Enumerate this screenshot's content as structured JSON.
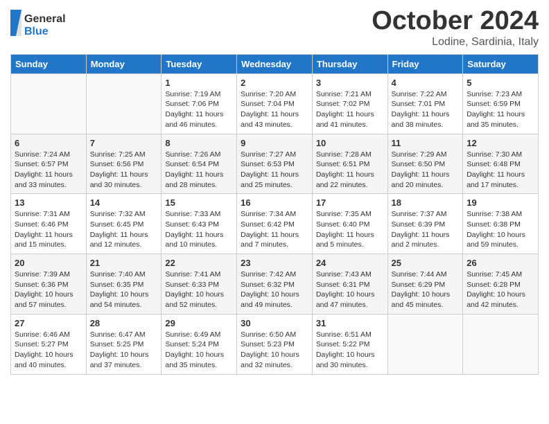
{
  "header": {
    "logo_general": "General",
    "logo_blue": "Blue",
    "month": "October 2024",
    "location": "Lodine, Sardinia, Italy"
  },
  "days_of_week": [
    "Sunday",
    "Monday",
    "Tuesday",
    "Wednesday",
    "Thursday",
    "Friday",
    "Saturday"
  ],
  "weeks": [
    [
      {
        "day": "",
        "sunrise": "",
        "sunset": "",
        "daylight": ""
      },
      {
        "day": "",
        "sunrise": "",
        "sunset": "",
        "daylight": ""
      },
      {
        "day": "1",
        "sunrise": "Sunrise: 7:19 AM",
        "sunset": "Sunset: 7:06 PM",
        "daylight": "Daylight: 11 hours and 46 minutes."
      },
      {
        "day": "2",
        "sunrise": "Sunrise: 7:20 AM",
        "sunset": "Sunset: 7:04 PM",
        "daylight": "Daylight: 11 hours and 43 minutes."
      },
      {
        "day": "3",
        "sunrise": "Sunrise: 7:21 AM",
        "sunset": "Sunset: 7:02 PM",
        "daylight": "Daylight: 11 hours and 41 minutes."
      },
      {
        "day": "4",
        "sunrise": "Sunrise: 7:22 AM",
        "sunset": "Sunset: 7:01 PM",
        "daylight": "Daylight: 11 hours and 38 minutes."
      },
      {
        "day": "5",
        "sunrise": "Sunrise: 7:23 AM",
        "sunset": "Sunset: 6:59 PM",
        "daylight": "Daylight: 11 hours and 35 minutes."
      }
    ],
    [
      {
        "day": "6",
        "sunrise": "Sunrise: 7:24 AM",
        "sunset": "Sunset: 6:57 PM",
        "daylight": "Daylight: 11 hours and 33 minutes."
      },
      {
        "day": "7",
        "sunrise": "Sunrise: 7:25 AM",
        "sunset": "Sunset: 6:56 PM",
        "daylight": "Daylight: 11 hours and 30 minutes."
      },
      {
        "day": "8",
        "sunrise": "Sunrise: 7:26 AM",
        "sunset": "Sunset: 6:54 PM",
        "daylight": "Daylight: 11 hours and 28 minutes."
      },
      {
        "day": "9",
        "sunrise": "Sunrise: 7:27 AM",
        "sunset": "Sunset: 6:53 PM",
        "daylight": "Daylight: 11 hours and 25 minutes."
      },
      {
        "day": "10",
        "sunrise": "Sunrise: 7:28 AM",
        "sunset": "Sunset: 6:51 PM",
        "daylight": "Daylight: 11 hours and 22 minutes."
      },
      {
        "day": "11",
        "sunrise": "Sunrise: 7:29 AM",
        "sunset": "Sunset: 6:50 PM",
        "daylight": "Daylight: 11 hours and 20 minutes."
      },
      {
        "day": "12",
        "sunrise": "Sunrise: 7:30 AM",
        "sunset": "Sunset: 6:48 PM",
        "daylight": "Daylight: 11 hours and 17 minutes."
      }
    ],
    [
      {
        "day": "13",
        "sunrise": "Sunrise: 7:31 AM",
        "sunset": "Sunset: 6:46 PM",
        "daylight": "Daylight: 11 hours and 15 minutes."
      },
      {
        "day": "14",
        "sunrise": "Sunrise: 7:32 AM",
        "sunset": "Sunset: 6:45 PM",
        "daylight": "Daylight: 11 hours and 12 minutes."
      },
      {
        "day": "15",
        "sunrise": "Sunrise: 7:33 AM",
        "sunset": "Sunset: 6:43 PM",
        "daylight": "Daylight: 11 hours and 10 minutes."
      },
      {
        "day": "16",
        "sunrise": "Sunrise: 7:34 AM",
        "sunset": "Sunset: 6:42 PM",
        "daylight": "Daylight: 11 hours and 7 minutes."
      },
      {
        "day": "17",
        "sunrise": "Sunrise: 7:35 AM",
        "sunset": "Sunset: 6:40 PM",
        "daylight": "Daylight: 11 hours and 5 minutes."
      },
      {
        "day": "18",
        "sunrise": "Sunrise: 7:37 AM",
        "sunset": "Sunset: 6:39 PM",
        "daylight": "Daylight: 11 hours and 2 minutes."
      },
      {
        "day": "19",
        "sunrise": "Sunrise: 7:38 AM",
        "sunset": "Sunset: 6:38 PM",
        "daylight": "Daylight: 10 hours and 59 minutes."
      }
    ],
    [
      {
        "day": "20",
        "sunrise": "Sunrise: 7:39 AM",
        "sunset": "Sunset: 6:36 PM",
        "daylight": "Daylight: 10 hours and 57 minutes."
      },
      {
        "day": "21",
        "sunrise": "Sunrise: 7:40 AM",
        "sunset": "Sunset: 6:35 PM",
        "daylight": "Daylight: 10 hours and 54 minutes."
      },
      {
        "day": "22",
        "sunrise": "Sunrise: 7:41 AM",
        "sunset": "Sunset: 6:33 PM",
        "daylight": "Daylight: 10 hours and 52 minutes."
      },
      {
        "day": "23",
        "sunrise": "Sunrise: 7:42 AM",
        "sunset": "Sunset: 6:32 PM",
        "daylight": "Daylight: 10 hours and 49 minutes."
      },
      {
        "day": "24",
        "sunrise": "Sunrise: 7:43 AM",
        "sunset": "Sunset: 6:31 PM",
        "daylight": "Daylight: 10 hours and 47 minutes."
      },
      {
        "day": "25",
        "sunrise": "Sunrise: 7:44 AM",
        "sunset": "Sunset: 6:29 PM",
        "daylight": "Daylight: 10 hours and 45 minutes."
      },
      {
        "day": "26",
        "sunrise": "Sunrise: 7:45 AM",
        "sunset": "Sunset: 6:28 PM",
        "daylight": "Daylight: 10 hours and 42 minutes."
      }
    ],
    [
      {
        "day": "27",
        "sunrise": "Sunrise: 6:46 AM",
        "sunset": "Sunset: 5:27 PM",
        "daylight": "Daylight: 10 hours and 40 minutes."
      },
      {
        "day": "28",
        "sunrise": "Sunrise: 6:47 AM",
        "sunset": "Sunset: 5:25 PM",
        "daylight": "Daylight: 10 hours and 37 minutes."
      },
      {
        "day": "29",
        "sunrise": "Sunrise: 6:49 AM",
        "sunset": "Sunset: 5:24 PM",
        "daylight": "Daylight: 10 hours and 35 minutes."
      },
      {
        "day": "30",
        "sunrise": "Sunrise: 6:50 AM",
        "sunset": "Sunset: 5:23 PM",
        "daylight": "Daylight: 10 hours and 32 minutes."
      },
      {
        "day": "31",
        "sunrise": "Sunrise: 6:51 AM",
        "sunset": "Sunset: 5:22 PM",
        "daylight": "Daylight: 10 hours and 30 minutes."
      },
      {
        "day": "",
        "sunrise": "",
        "sunset": "",
        "daylight": ""
      },
      {
        "day": "",
        "sunrise": "",
        "sunset": "",
        "daylight": ""
      }
    ]
  ]
}
